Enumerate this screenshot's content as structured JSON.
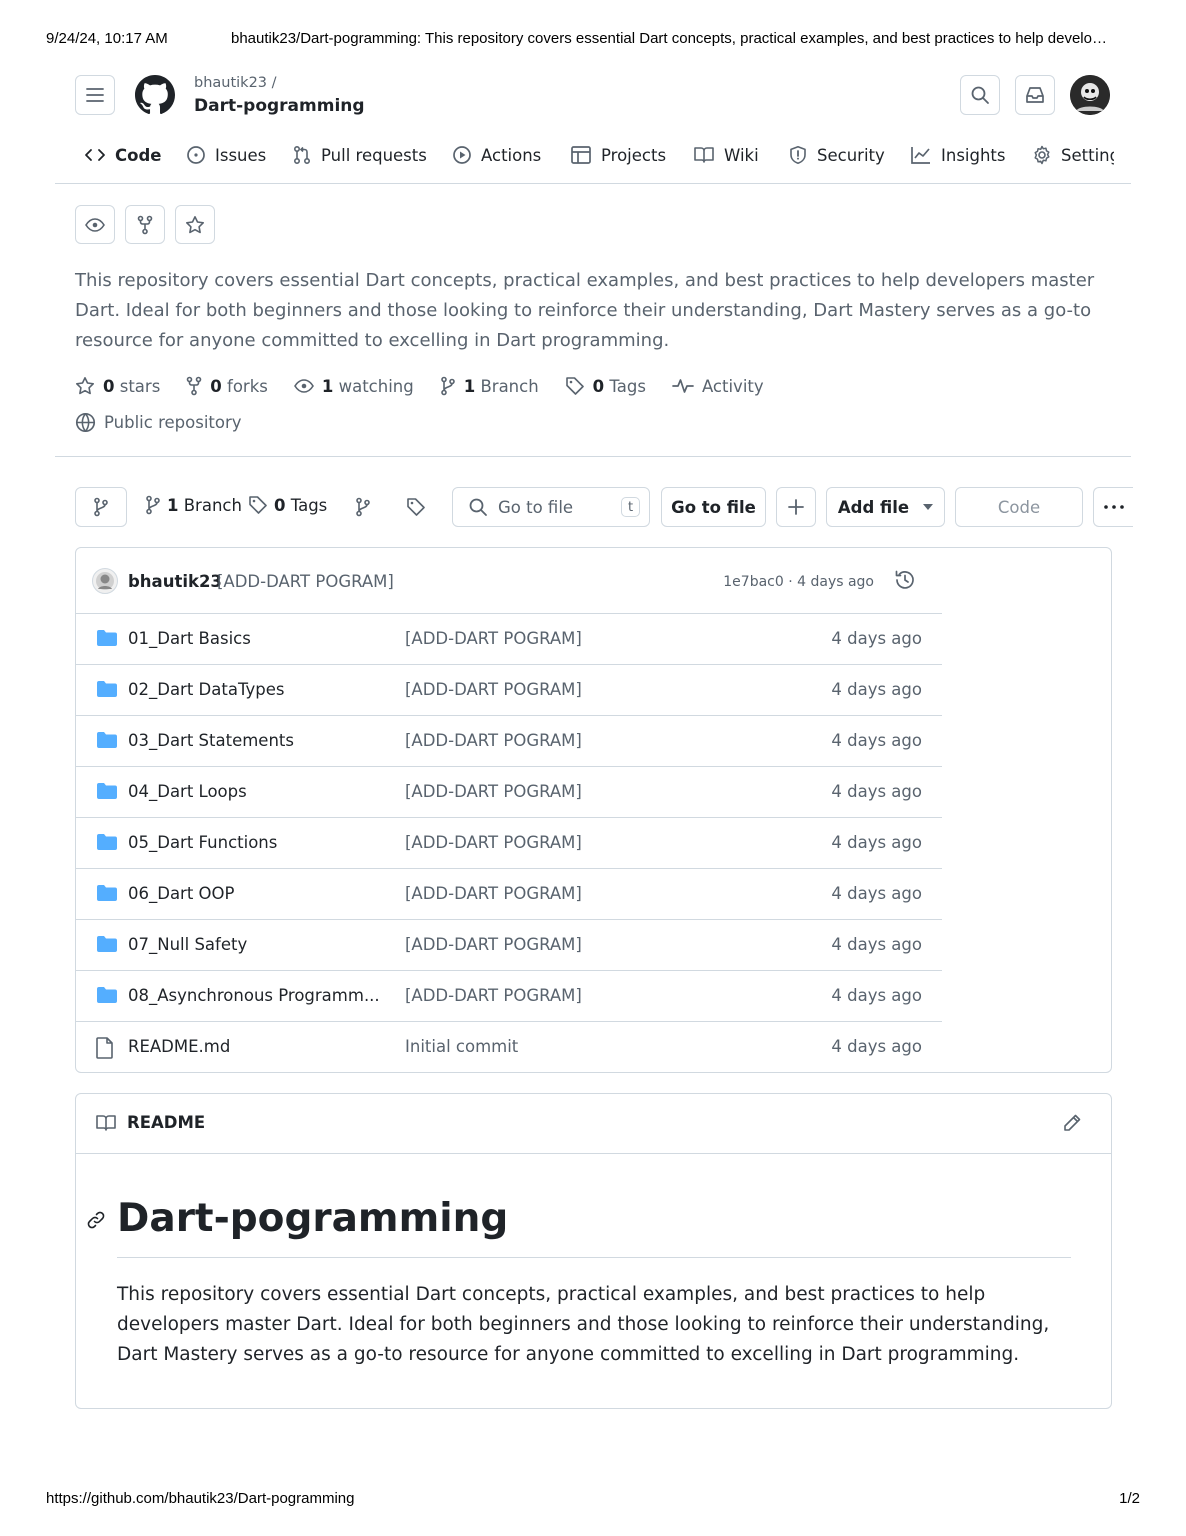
{
  "print_header": {
    "datetime": "9/24/24, 10:17 AM",
    "page_title": "bhautik23/Dart-pogramming: This repository covers essential Dart concepts, practical examples, and best practices to help develo…"
  },
  "print_footer": {
    "url": "https://github.com/bhautik23/Dart-pogramming",
    "page_number": "1/2"
  },
  "header": {
    "owner": "bhautik23 /",
    "repo": "Dart-pogramming"
  },
  "tabs": [
    {
      "label": "Code",
      "icon": "code-icon"
    },
    {
      "label": "Issues",
      "icon": "issue-icon"
    },
    {
      "label": "Pull requests",
      "icon": "pull-request-icon"
    },
    {
      "label": "Actions",
      "icon": "play-icon"
    },
    {
      "label": "Projects",
      "icon": "table-icon"
    },
    {
      "label": "Wiki",
      "icon": "book-icon"
    },
    {
      "label": "Security",
      "icon": "shield-icon"
    },
    {
      "label": "Insights",
      "icon": "graph-icon"
    },
    {
      "label": "Setting",
      "icon": "gear-icon"
    }
  ],
  "description": "This repository covers essential Dart concepts, practical examples, and best practices to help developers master Dart. Ideal for both beginners and those looking to reinforce their understanding, Dart Mastery serves as a go-to resource for anyone committed to excelling in Dart programming.",
  "stats": {
    "stars_count": "0",
    "stars_label": "stars",
    "forks_count": "0",
    "forks_label": "forks",
    "watching_count": "1",
    "watching_label": "watching",
    "branch_count": "1",
    "branch_label": "Branch",
    "tags_count": "0",
    "tags_label": "Tags",
    "activity_label": "Activity",
    "visibility": "Public repository"
  },
  "filebar": {
    "branch_count": "1",
    "branch_label": "Branch",
    "tags_count": "0",
    "tags_label": "Tags",
    "search_placeholder": "Go to file",
    "search_shortcut": "t",
    "go_to_file": "Go to file",
    "add_file": "Add file",
    "code": "Code"
  },
  "latest_commit": {
    "author": "bhautik23",
    "message": "[ADD-DART POGRAM]",
    "sha_age": "1e7bac0 · 4 days ago"
  },
  "files": [
    {
      "name": "01_Dart Basics",
      "message": "[ADD-DART POGRAM]",
      "age": "4 days ago",
      "type": "folder"
    },
    {
      "name": "02_Dart DataTypes",
      "message": "[ADD-DART POGRAM]",
      "age": "4 days ago",
      "type": "folder"
    },
    {
      "name": "03_Dart Statements",
      "message": "[ADD-DART POGRAM]",
      "age": "4 days ago",
      "type": "folder"
    },
    {
      "name": "04_Dart Loops",
      "message": "[ADD-DART POGRAM]",
      "age": "4 days ago",
      "type": "folder"
    },
    {
      "name": "05_Dart Functions",
      "message": "[ADD-DART POGRAM]",
      "age": "4 days ago",
      "type": "folder"
    },
    {
      "name": "06_Dart OOP",
      "message": "[ADD-DART POGRAM]",
      "age": "4 days ago",
      "type": "folder"
    },
    {
      "name": "07_Null Safety",
      "message": "[ADD-DART POGRAM]",
      "age": "4 days ago",
      "type": "folder"
    },
    {
      "name": "08_Asynchronous Programm...",
      "message": "[ADD-DART POGRAM]",
      "age": "4 days ago",
      "type": "folder"
    },
    {
      "name": "README.md",
      "message": "Initial commit",
      "age": "4 days ago",
      "type": "file"
    }
  ],
  "readme": {
    "tab_label": "README",
    "heading": "Dart-pogramming",
    "body": "This repository covers essential Dart concepts, practical examples, and best practices to help developers master Dart. Ideal for both beginners and those looking to reinforce their understanding, Dart Mastery serves as a go-to resource for anyone committed to excelling in Dart programming."
  },
  "colors": {
    "text": "#1f2328",
    "muted": "#59636e",
    "border": "#d1d9e0",
    "folder": "#54aeff"
  }
}
